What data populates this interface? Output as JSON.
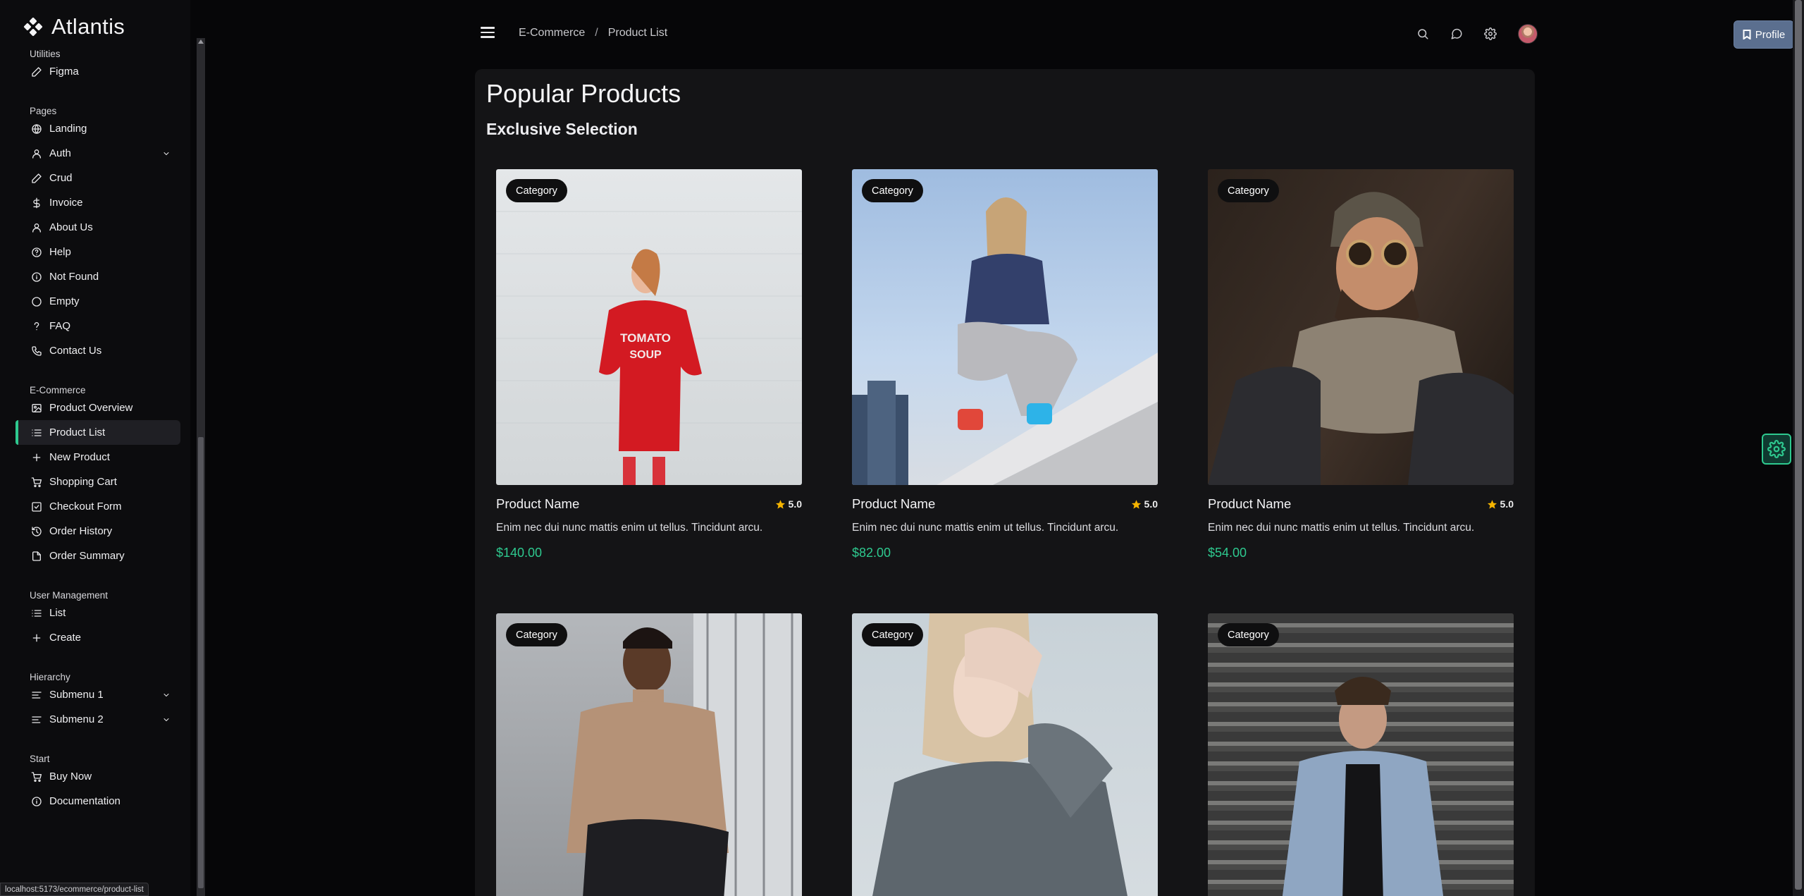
{
  "app": {
    "name": "Atlantis"
  },
  "sidebar": {
    "sections": [
      {
        "title": "Utilities",
        "items": [
          {
            "label": "Figma",
            "icon": "pencil-icon"
          }
        ]
      },
      {
        "title": "Pages",
        "items": [
          {
            "label": "Landing",
            "icon": "globe-icon"
          },
          {
            "label": "Auth",
            "icon": "user-icon",
            "expandable": true
          },
          {
            "label": "Crud",
            "icon": "pencil-icon"
          },
          {
            "label": "Invoice",
            "icon": "dollar-icon"
          },
          {
            "label": "About Us",
            "icon": "user-icon"
          },
          {
            "label": "Help",
            "icon": "help-circle-icon"
          },
          {
            "label": "Not Found",
            "icon": "info-circle-icon"
          },
          {
            "label": "Empty",
            "icon": "circle-icon"
          },
          {
            "label": "FAQ",
            "icon": "question-icon"
          },
          {
            "label": "Contact Us",
            "icon": "phone-icon"
          }
        ]
      },
      {
        "title": "E-Commerce",
        "items": [
          {
            "label": "Product Overview",
            "icon": "image-icon"
          },
          {
            "label": "Product List",
            "icon": "list-icon",
            "active": true
          },
          {
            "label": "New Product",
            "icon": "plus-icon"
          },
          {
            "label": "Shopping Cart",
            "icon": "cart-icon"
          },
          {
            "label": "Checkout Form",
            "icon": "check-square-icon"
          },
          {
            "label": "Order History",
            "icon": "history-icon"
          },
          {
            "label": "Order Summary",
            "icon": "file-icon"
          }
        ]
      },
      {
        "title": "User Management",
        "items": [
          {
            "label": "List",
            "icon": "list-icon"
          },
          {
            "label": "Create",
            "icon": "plus-icon"
          }
        ]
      },
      {
        "title": "Hierarchy",
        "items": [
          {
            "label": "Submenu 1",
            "icon": "align-icon",
            "expandable": true
          },
          {
            "label": "Submenu 2",
            "icon": "align-icon",
            "expandable": true
          }
        ]
      },
      {
        "title": "Start",
        "items": [
          {
            "label": "Buy Now",
            "icon": "cart-icon"
          },
          {
            "label": "Documentation",
            "icon": "info-circle-icon"
          }
        ]
      }
    ]
  },
  "topbar": {
    "breadcrumb": [
      "E-Commerce",
      "/",
      "Product List"
    ],
    "icons": [
      "search-icon",
      "chat-icon",
      "gear-icon",
      "avatar"
    ],
    "profile_label": "Profile"
  },
  "main": {
    "title": "Popular Products",
    "subtitle": "Exclusive Selection",
    "products": [
      {
        "badge": "Category",
        "name": "Product Name",
        "rating": "5.0",
        "desc": "Enim nec dui nunc mattis enim ut tellus. Tincidunt arcu.",
        "price": "$140.00"
      },
      {
        "badge": "Category",
        "name": "Product Name",
        "rating": "5.0",
        "desc": "Enim nec dui nunc mattis enim ut tellus. Tincidunt arcu.",
        "price": "$82.00"
      },
      {
        "badge": "Category",
        "name": "Product Name",
        "rating": "5.0",
        "desc": "Enim nec dui nunc mattis enim ut tellus. Tincidunt arcu.",
        "price": "$54.00"
      },
      {
        "badge": "Category"
      },
      {
        "badge": "Category"
      },
      {
        "badge": "Category"
      }
    ]
  },
  "status_url": "localhost:5173/ecommerce/product-list",
  "colors": {
    "accent": "#2ec98f",
    "profile_button": "#5b6f8f",
    "background": "#060608",
    "panel": "#141416"
  }
}
